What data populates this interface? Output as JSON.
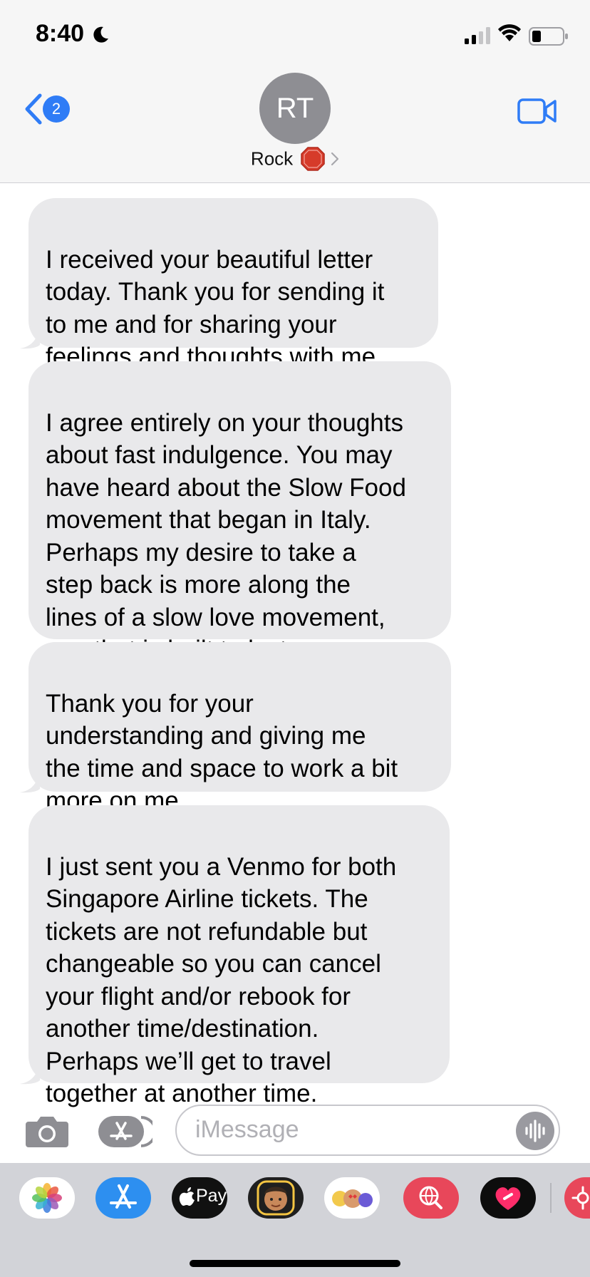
{
  "status_bar": {
    "time": "8:40",
    "icons": [
      "moon-icon",
      "cellular-signal-icon",
      "wifi-icon",
      "battery-icon"
    ]
  },
  "header": {
    "back_badge_count": "2",
    "avatar_initials": "RT",
    "contact_name": "Rock",
    "contact_emoji": "stop-sign-emoji",
    "facetime_icon": "video-camera-icon",
    "accent_color": "#2f7cf6"
  },
  "messages": [
    {
      "text": "I received your beautiful letter\ntoday. Thank you for sending it\nto me and for sharing your\nfeelings and thoughts with me."
    },
    {
      "text": "I agree entirely on your thoughts\nabout fast indulgence. You may\nhave heard about the Slow Food\nmovement that began in Italy.\nPerhaps my desire to take a\nstep back is more along the\nlines of a slow love movement,\none that is built to last."
    },
    {
      "text": "Thank you for your\nunderstanding and giving me\nthe time and space to work a bit\nmore on me"
    },
    {
      "text": "I just sent you a Venmo for both\nSingapore Airline tickets. The\ntickets are not refundable but\nchangeable so you can cancel\nyour flight and/or rebook for\nanother time/destination.\nPerhaps we’ll get to travel\ntogether at another time."
    }
  ],
  "input_bar": {
    "placeholder": "iMessage",
    "icons": [
      "camera-icon",
      "app-store-icon",
      "audio-waveform-icon"
    ]
  },
  "app_drawer": {
    "apple_pay_label": "Pay",
    "apps": [
      "photos-app-icon",
      "app-store-app-icon",
      "apple-pay-app-icon",
      "memoji-app-icon",
      "animoji-stickers-app-icon",
      "web-search-app-icon",
      "digital-touch-app-icon",
      "partial-app-icon"
    ]
  },
  "bubble_color": "#e9e9eb"
}
